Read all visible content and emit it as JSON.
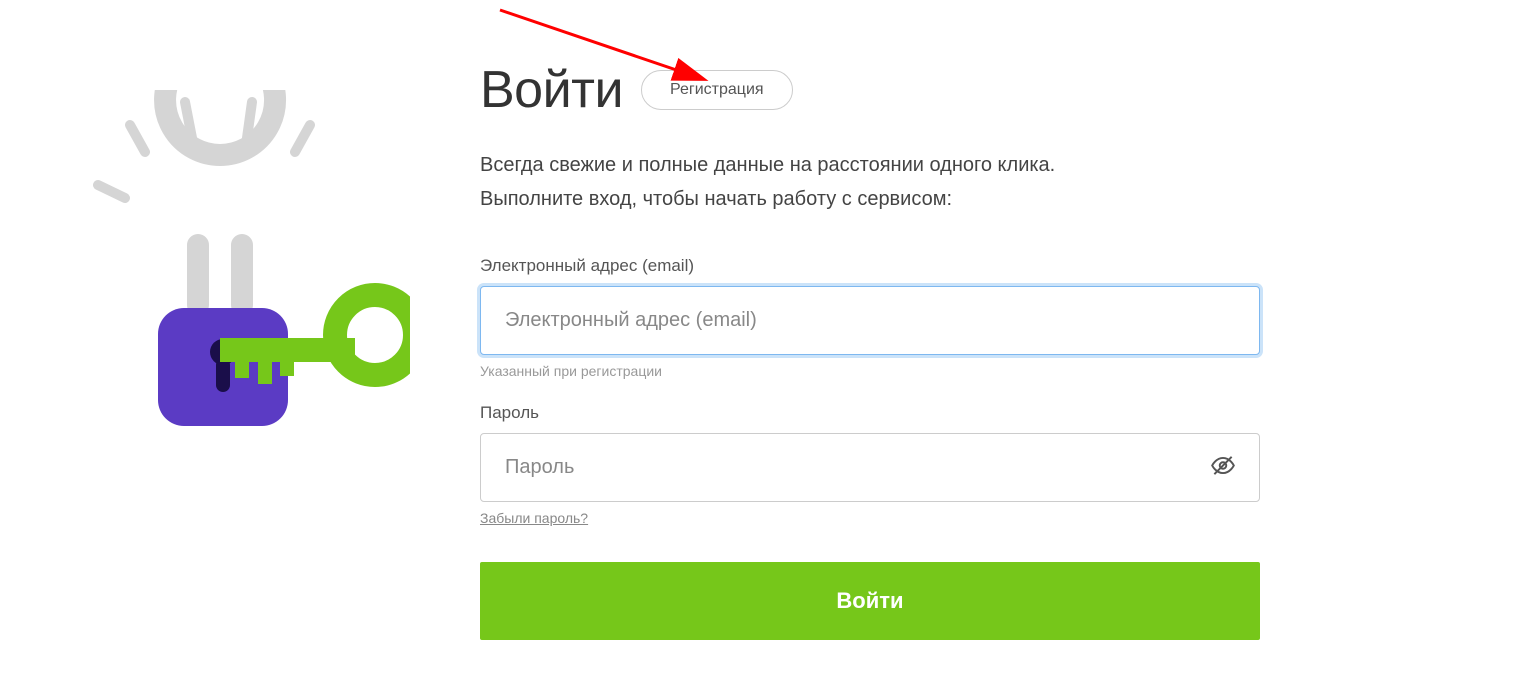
{
  "header": {
    "title": "Войти",
    "register_label": "Регистрация"
  },
  "subtitle": {
    "line1": "Всегда свежие и полные данные на расстоянии одного клика.",
    "line2": "Выполните вход, чтобы начать работу с сервисом:"
  },
  "email": {
    "label": "Электронный адрес (email)",
    "placeholder": "Электронный адрес (email)",
    "hint": "Указанный при регистрации",
    "value": ""
  },
  "password": {
    "label": "Пароль",
    "placeholder": "Пароль",
    "forgot_link": "Забыли пароль?",
    "value": ""
  },
  "submit": {
    "label": "Войти"
  },
  "colors": {
    "accent_green": "#76c71a",
    "lock_purple": "#5b3bc4",
    "focus_blue": "#7eb8f0"
  }
}
